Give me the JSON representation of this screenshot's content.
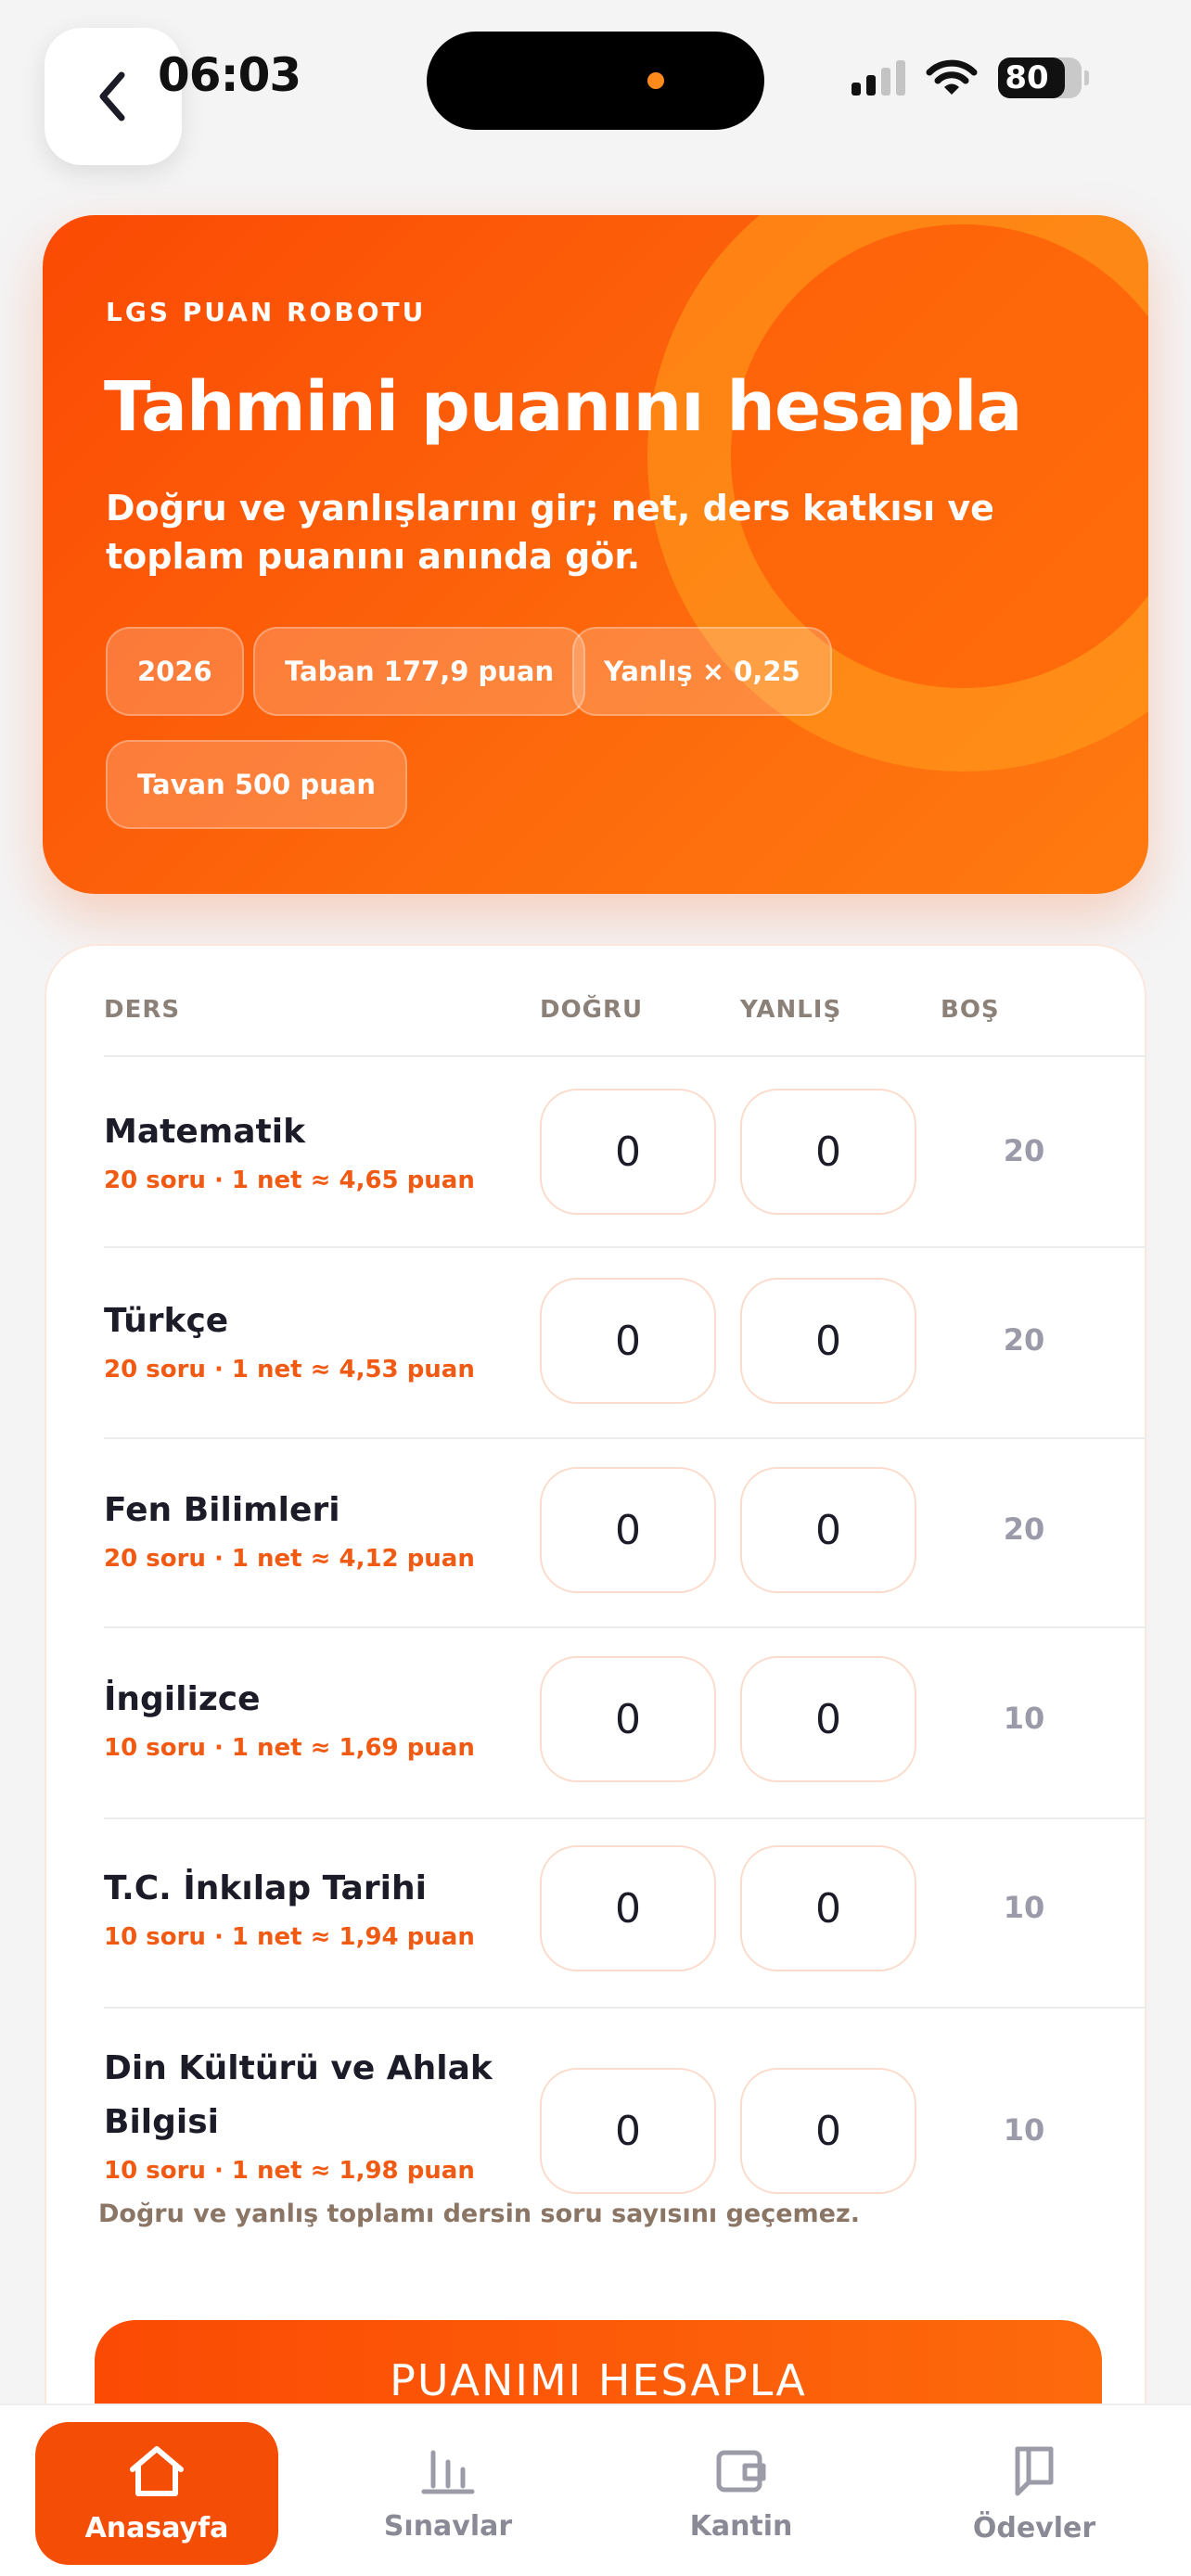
{
  "status_bar": {
    "time": "06:03",
    "battery": "80"
  },
  "hero": {
    "kicker": "LGS PUAN ROBOTU",
    "title": "Tahmini puanını hesapla",
    "description": "Doğru ve yanlışlarını gir; net, ders katkısı ve toplam puanını anında gör.",
    "chips": [
      "2026",
      "Taban 177,9 puan",
      "Yanlış × 0,25",
      "Tavan 500 puan"
    ]
  },
  "table": {
    "headers": {
      "subject": "DERS",
      "correct": "DOĞRU",
      "wrong": "YANLIŞ",
      "blank": "BOŞ"
    },
    "rows": [
      {
        "name": "Matematik",
        "meta": "20 soru · 1 net ≈ 4,65 puan",
        "correct": "0",
        "wrong": "0",
        "blank": "20"
      },
      {
        "name": "Türkçe",
        "meta": "20 soru · 1 net ≈ 4,53 puan",
        "correct": "0",
        "wrong": "0",
        "blank": "20"
      },
      {
        "name": "Fen Bilimleri",
        "meta": "20 soru · 1 net ≈ 4,12 puan",
        "correct": "0",
        "wrong": "0",
        "blank": "20"
      },
      {
        "name": "İngilizce",
        "meta": "10 soru · 1 net ≈ 1,69 puan",
        "correct": "0",
        "wrong": "0",
        "blank": "10"
      },
      {
        "name": "T.C. İnkılap Tarihi",
        "meta": "10 soru · 1 net ≈ 1,94 puan",
        "correct": "0",
        "wrong": "0",
        "blank": "10"
      },
      {
        "name": "Din Kültürü ve Ahlak Bilgisi",
        "meta": "10 soru · 1 net ≈ 1,98 puan",
        "correct": "0",
        "wrong": "0",
        "blank": "10"
      }
    ],
    "note": "Doğru ve yanlış toplamı dersin soru sayısını geçemez."
  },
  "cta_label": "PUANIMI HESAPLA",
  "tabs": [
    {
      "label": "Anasayfa",
      "icon": "home-icon"
    },
    {
      "label": "Sınavlar",
      "icon": "bar-chart-icon"
    },
    {
      "label": "Kantin",
      "icon": "wallet-icon"
    },
    {
      "label": "Ödevler",
      "icon": "book-icon"
    }
  ],
  "colors": {
    "accent": "#f44d06",
    "meta_text": "#f05a12"
  }
}
